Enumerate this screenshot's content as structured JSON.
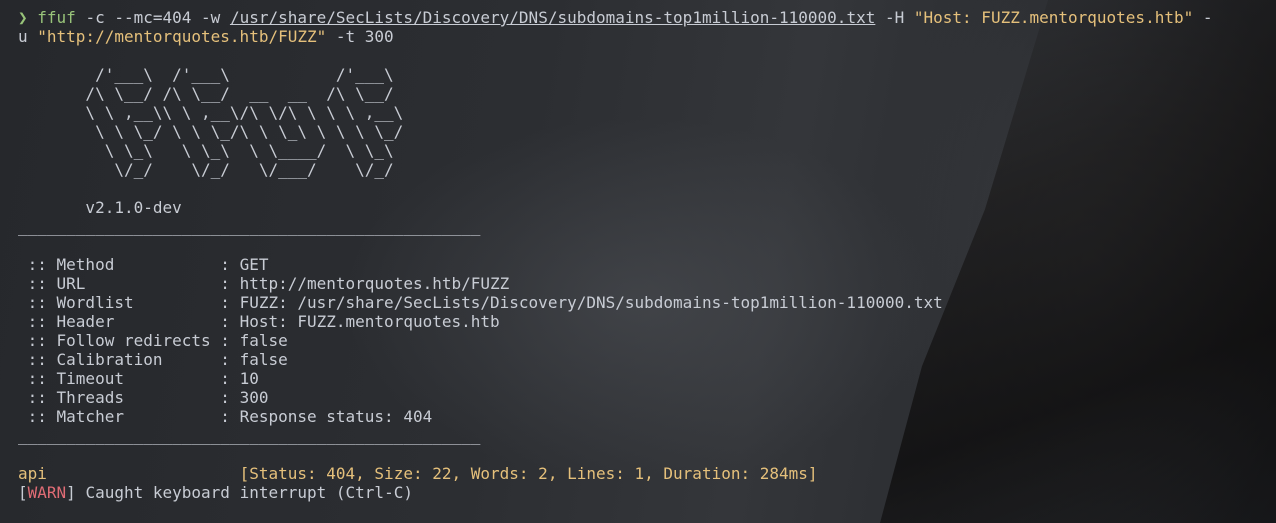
{
  "command": {
    "prompt": "❯",
    "name": "ffuf",
    "part1": " -c --mc=404 -w ",
    "wordlist": "/usr/share/SecLists/Discovery/DNS/subdomains-top1million-110000.txt",
    "part2": " -H ",
    "header": "\"Host: FUZZ.mentorquotes.htb\"",
    "part3": " -",
    "cont_flag": "u ",
    "url": "\"http://mentorquotes.htb/FUZZ\"",
    "part4": " -t 300"
  },
  "banner": {
    "art": [
      "        /'___\\  /'___\\           /'___\\",
      "       /\\ \\__/ /\\ \\__/  __  __  /\\ \\__/",
      "       \\ \\ ,__\\\\ \\ ,__\\/\\ \\/\\ \\ \\ \\ ,__\\",
      "        \\ \\ \\_/ \\ \\ \\_/\\ \\ \\_\\ \\ \\ \\ \\_/",
      "         \\ \\_\\   \\ \\_\\  \\ \\____/  \\ \\_\\",
      "          \\/_/    \\/_/   \\/___/    \\/_/"
    ],
    "version": "       v2.1.0-dev"
  },
  "rule": "________________________________________________",
  "config": [
    {
      "key": " :: Method           : ",
      "value": "GET"
    },
    {
      "key": " :: URL              : ",
      "value": "http://mentorquotes.htb/FUZZ"
    },
    {
      "key": " :: Wordlist         : ",
      "value": "FUZZ: /usr/share/SecLists/Discovery/DNS/subdomains-top1million-110000.txt"
    },
    {
      "key": " :: Header           : ",
      "value": "Host: FUZZ.mentorquotes.htb"
    },
    {
      "key": " :: Follow redirects : ",
      "value": "false"
    },
    {
      "key": " :: Calibration      : ",
      "value": "false"
    },
    {
      "key": " :: Timeout          : ",
      "value": "10"
    },
    {
      "key": " :: Threads          : ",
      "value": "300"
    },
    {
      "key": " :: Matcher          : ",
      "value": "Response status: 404"
    }
  ],
  "result": {
    "word": "api",
    "padding": "                    ",
    "info": "[Status: 404, Size: 22, Words: 2, Lines: 1, Duration: 284ms]"
  },
  "warn": {
    "open": "[",
    "tag": "WARN",
    "close": "]",
    "message": " Caught keyboard interrupt (Ctrl-C)"
  }
}
